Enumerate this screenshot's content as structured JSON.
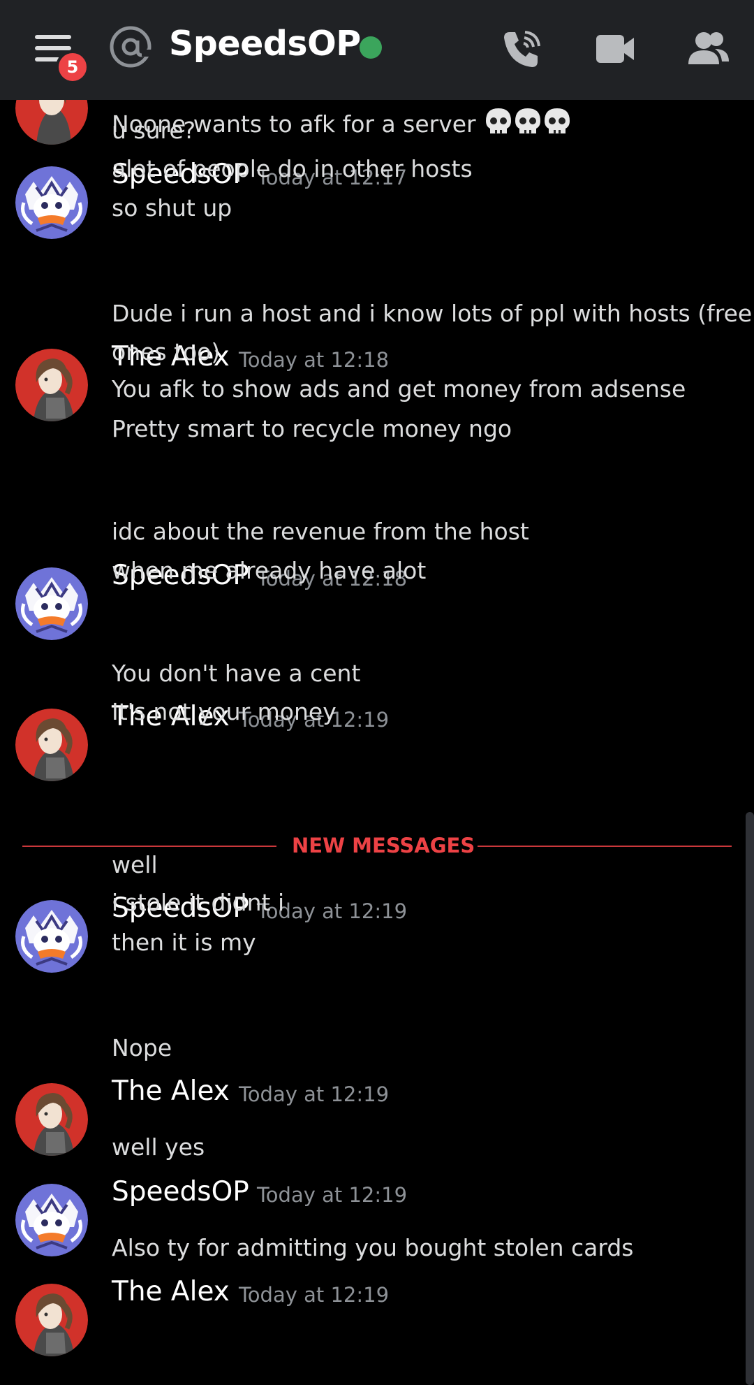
{
  "header": {
    "title": "SpeedsOP",
    "badge_count": "5",
    "icons": [
      "menu-icon",
      "at-icon",
      "call-icon",
      "video-icon",
      "members-icon"
    ],
    "status_color": "#3ba55c"
  },
  "chat": {
    "partial_message": {
      "text": "Noone wants to afk for a server",
      "emoji": "💀💀💀"
    },
    "messages": [
      {
        "user": "SpeedsOP",
        "time": "Today at 12:17",
        "lines": [
          "u sure?",
          "alot of people do in other hosts",
          "so shut up"
        ]
      },
      {
        "user": "The Alex",
        "time": "Today at 12:18",
        "lines": [
          "Dude i run a host and i know lots of ppl with hosts (free",
          "ones too)",
          "You afk to show ads and get money from adsense",
          "Pretty smart to recycle money ngo"
        ]
      },
      {
        "user": "SpeedsOP",
        "time": "Today at 12:18",
        "lines": [
          "idc about the revenue from the host",
          "when me already have alot"
        ]
      },
      {
        "user": "The Alex",
        "time": "Today at 12:19",
        "lines": [
          "You don't have a cent",
          "It's not your money"
        ]
      },
      {
        "user": "SpeedsOP",
        "time": "Today at 12:19",
        "lines": [
          "well",
          "i stole it didnt i",
          "then it is my"
        ]
      },
      {
        "user": "The Alex",
        "time": "Today at 12:19",
        "lines": [
          "Nope"
        ]
      },
      {
        "user": "SpeedsOP",
        "time": "Today at 12:19",
        "lines": [
          "well yes"
        ]
      },
      {
        "user": "The Alex",
        "time": "Today at 12:19",
        "lines": [
          "Also ty for admitting you bought stolen cards"
        ]
      }
    ],
    "new_messages_label": "NEW MESSAGES"
  },
  "colors": {
    "header_bg": "#202225",
    "chat_bg": "#000000",
    "new_messages": "#ed4245",
    "timestamp": "#8e9297"
  }
}
